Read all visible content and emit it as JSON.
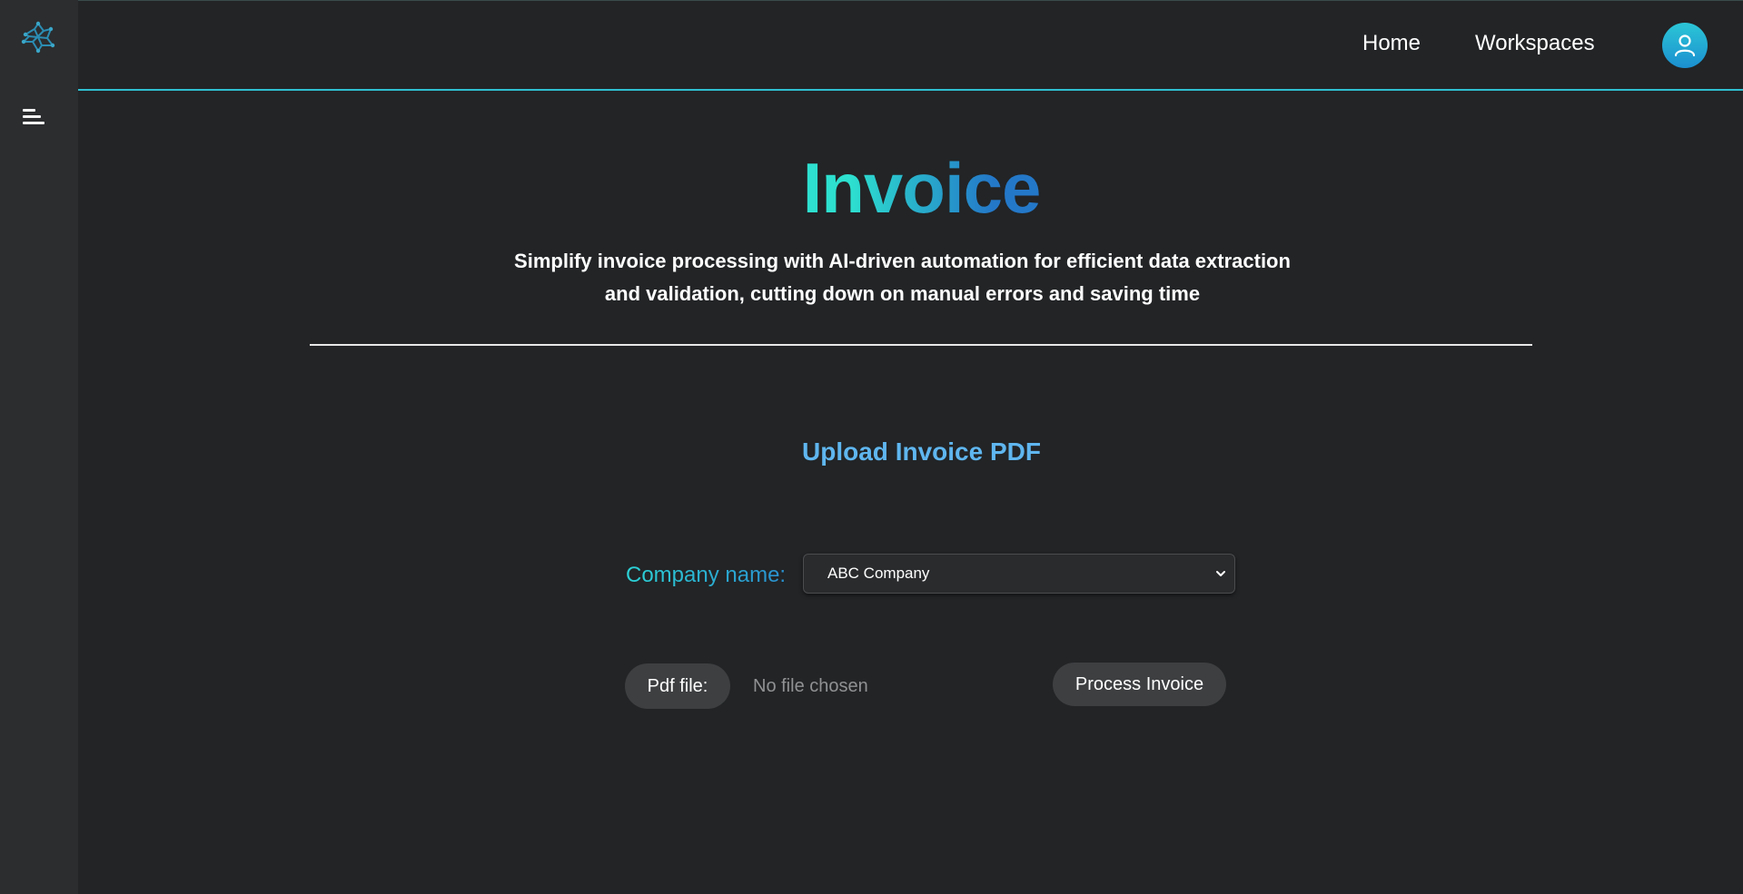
{
  "header": {
    "nav": [
      {
        "label": "Home"
      },
      {
        "label": "Workspaces"
      }
    ]
  },
  "main": {
    "title": "Invoice",
    "subtitle": "Simplify invoice processing with AI-driven automation for efficient data extraction and validation, cutting down on manual errors and saving time",
    "section_title": "Upload Invoice PDF",
    "form": {
      "company_label": "Company name:",
      "company_selected": "ABC Company",
      "pdf_label": "Pdf file:",
      "file_status": "No file chosen",
      "submit_label": "Process Invoice"
    }
  },
  "icons": {
    "logo": "brand-logo-icon",
    "menu": "menu-toggle-icon",
    "avatar": "user-icon",
    "select": "chevron-down-icon"
  },
  "colors": {
    "background": "#222426",
    "sidebar": "#2b2d2f",
    "accent": "#2fbfd0",
    "section_title": "#5fb6ef",
    "button": "#3d3f41"
  }
}
